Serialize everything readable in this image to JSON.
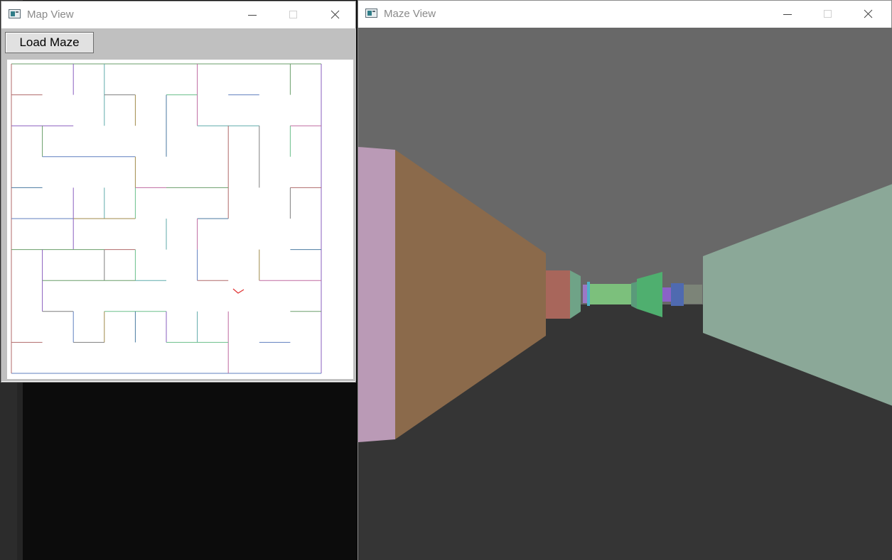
{
  "windows": {
    "map": {
      "title": "Map View",
      "load_button_label": "Load Maze"
    },
    "maze": {
      "title": "Maze View"
    }
  },
  "icons": {
    "app": "app-window-icon",
    "minimize": "minimize-icon",
    "maximize": "maximize-icon",
    "close": "close-icon",
    "player": "player-marker-icon"
  },
  "colors": {
    "ceiling": "#686868",
    "floor": "#353535",
    "map_background": "#ffffff",
    "map_client": "#c0c0c0",
    "player_marker": "#e03030",
    "desktop": "#0c0c0c"
  },
  "maze_view_walls": [
    {
      "color": "#ba9ab6"
    },
    {
      "color": "#8b6a4b"
    },
    {
      "color": "#a8665b"
    },
    {
      "color": "#6fa387"
    },
    {
      "color": "#7cc07c"
    },
    {
      "color": "#4faf6f"
    },
    {
      "color": "#4f6ab0"
    },
    {
      "color": "#8b62c7"
    },
    {
      "color": "#7c8478"
    },
    {
      "color": "#8ba898"
    }
  ]
}
